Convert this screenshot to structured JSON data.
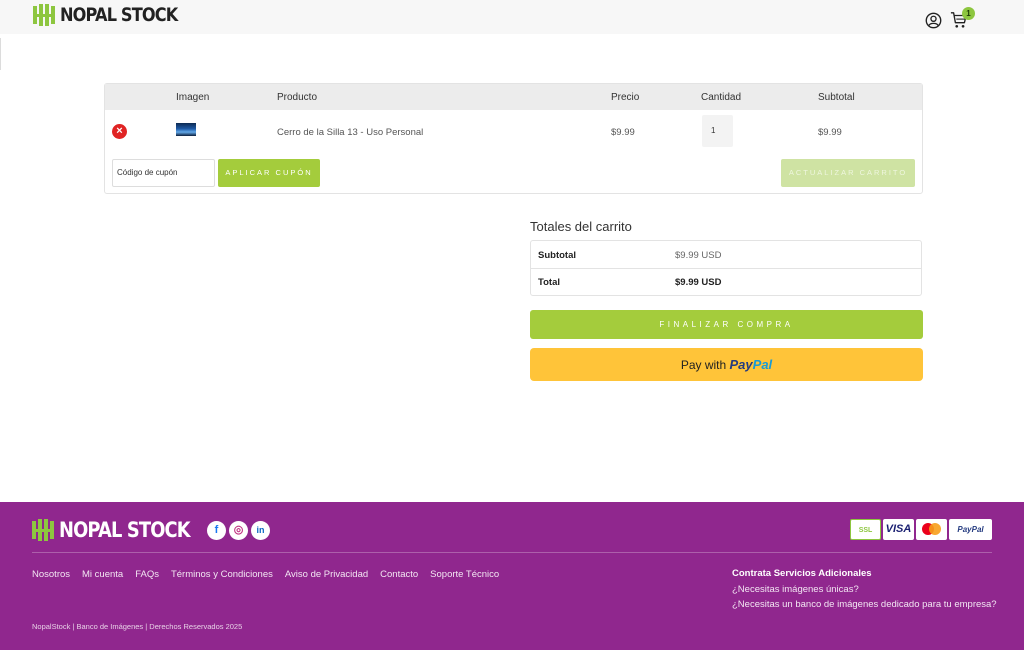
{
  "header": {
    "brand": "NOPAL STOCK",
    "cart_count": "1"
  },
  "cart": {
    "columns": [
      "Imagen",
      "Producto",
      "Precio",
      "Cantidad",
      "Subtotal"
    ],
    "item": {
      "product": "Cerro de la Silla 13 - Uso Personal",
      "price": "$9.99",
      "quantity": "1",
      "subtotal": "$9.99"
    },
    "coupon_placeholder": "Código de cupón",
    "apply_coupon_label": "APLICAR CUPÓN",
    "update_cart_label": "ACTUALIZAR CARRITO"
  },
  "totals": {
    "title": "Totales del carrito",
    "subtotal_label": "Subtotal",
    "subtotal_value": "$9.99 USD",
    "total_label": "Total",
    "total_value": "$9.99 USD",
    "checkout_label": "FINALIZAR COMPRA",
    "paypal_prefix": "Pay with",
    "paypal_brand_1": "Pay",
    "paypal_brand_2": "Pal"
  },
  "footer": {
    "brand": "NOPAL STOCK",
    "social_icons": [
      "facebook-icon",
      "instagram-icon",
      "linkedin-icon"
    ],
    "payment_badges": {
      "ssl": "SSL",
      "visa": "VISA",
      "paypal": "PayPal"
    },
    "links": [
      "Nosotros",
      "Mi cuenta",
      "FAQs",
      "Términos y Condiciones",
      "Aviso de Privacidad",
      "Contacto",
      "Soporte Técnico"
    ],
    "services_title": "Contrata Servicios Adicionales",
    "services_links": [
      "¿Necesitas imágenes únicas?",
      "¿Necesitas un banco de imágenes dedicado para tu empresa?"
    ],
    "copyright": "NopalStock | Banco de Imágenes | Derechos Reservados 2025"
  },
  "colors": {
    "accent_green": "#a4cc3c",
    "footer_purple": "#90278e",
    "paypal_yellow": "#ffc439",
    "remove_red": "#e02424"
  }
}
